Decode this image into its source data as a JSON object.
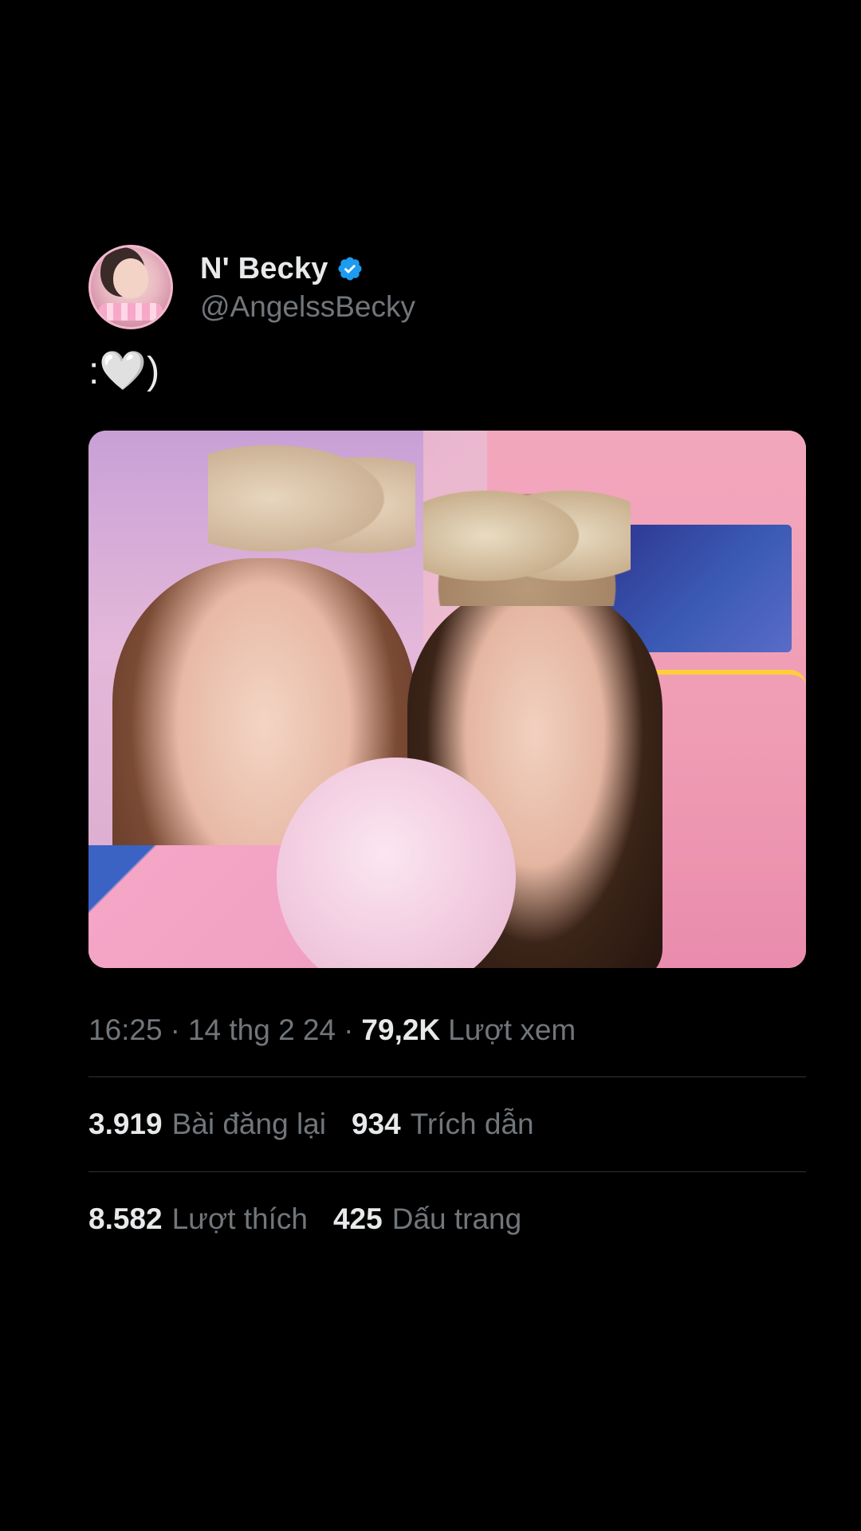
{
  "author": {
    "display_name": "N' Becky",
    "handle": "@AngelssBecky",
    "avatar_icon": "avatar-photo",
    "verified_icon": "verified-badge-icon",
    "verified_color": "#1d9bf0"
  },
  "post": {
    "text": ":🤍)",
    "media_description": ""
  },
  "meta": {
    "time": "16:25",
    "date": "14 thg 2 24",
    "views_count": "79,2K",
    "views_label": "Lượt xem",
    "separator": "·"
  },
  "stats": {
    "reposts_count": "3.919",
    "reposts_label": "Bài đăng lại",
    "quotes_count": "934",
    "quotes_label": "Trích dẫn",
    "likes_count": "8.582",
    "likes_label": "Lượt thích",
    "bookmarks_count": "425",
    "bookmarks_label": "Dấu trang"
  },
  "colors": {
    "background": "#000000",
    "primary_text": "#e7e9ea",
    "secondary_text": "#71767b",
    "divider": "#2f3336",
    "verified": "#1d9bf0"
  }
}
